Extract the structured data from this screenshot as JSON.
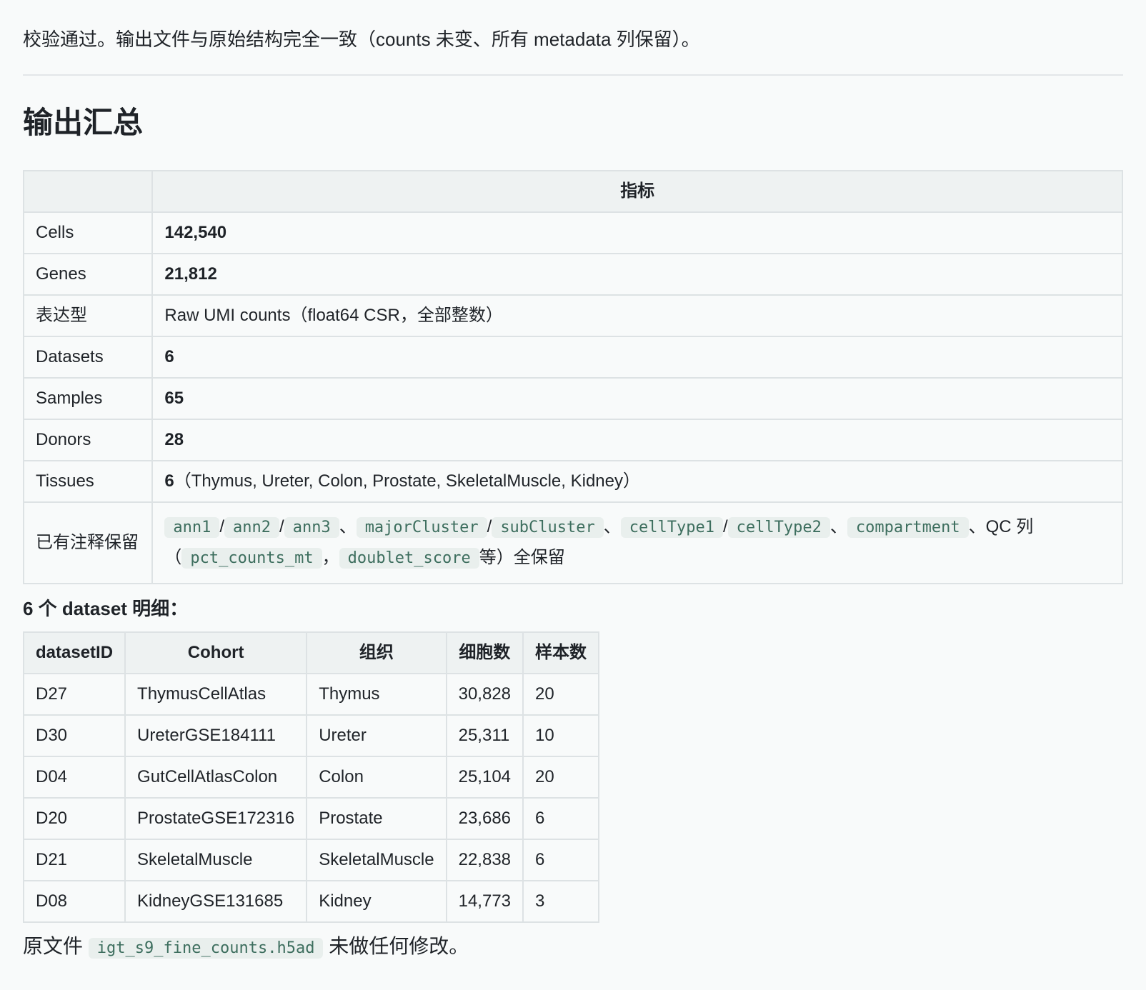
{
  "intro": "校验通过。输出文件与原始结构完全一致（counts 未变、所有 metadata 列保留）。",
  "heading": "输出汇总",
  "summary": {
    "header": [
      "",
      "指标"
    ],
    "rows": [
      {
        "label": "Cells",
        "value": "142,540"
      },
      {
        "label": "Genes",
        "value": "21,812"
      },
      {
        "label": "表达型",
        "value": "Raw UMI counts（float64 CSR，全部整数）"
      },
      {
        "label": "Datasets",
        "value": "6"
      },
      {
        "label": "Samples",
        "value": "65"
      },
      {
        "label": "Donors",
        "value": "28"
      },
      {
        "label": "Tissues",
        "value": "6",
        "extra": "（Thymus, Ureter, Colon, Prostate, SkeletalMuscle, Kidney）"
      }
    ],
    "annot": {
      "label": "已有注释保留",
      "codes": [
        "ann1",
        "ann2",
        "ann3",
        "majorCluster",
        "subCluster",
        "cellType1",
        "cellType2",
        "compartment",
        "pct_counts_mt",
        "doublet_score"
      ],
      "sep_slash": "/",
      "sep_dun": "、",
      "qc_text": "QC 列",
      "paren_open": "（",
      "comma": "，",
      "tail": "等）全保留"
    }
  },
  "detail_title": "6 个 dataset 明细：",
  "detail": {
    "headers": [
      "datasetID",
      "Cohort",
      "组织",
      "细胞数",
      "样本数"
    ],
    "rows": [
      [
        "D27",
        "ThymusCellAtlas",
        "Thymus",
        "30,828",
        "20"
      ],
      [
        "D30",
        "UreterGSE184111",
        "Ureter",
        "25,311",
        "10"
      ],
      [
        "D04",
        "GutCellAtlasColon",
        "Colon",
        "25,104",
        "20"
      ],
      [
        "D20",
        "ProstateGSE172316",
        "Prostate",
        "23,686",
        "6"
      ],
      [
        "D21",
        "SkeletalMuscle",
        "SkeletalMuscle",
        "22,838",
        "6"
      ],
      [
        "D08",
        "KidneyGSE131685",
        "Kidney",
        "14,773",
        "3"
      ]
    ]
  },
  "outro": {
    "before": "原文件",
    "code": "igt_s9_fine_counts.h5ad",
    "after": "未做任何修改。"
  }
}
